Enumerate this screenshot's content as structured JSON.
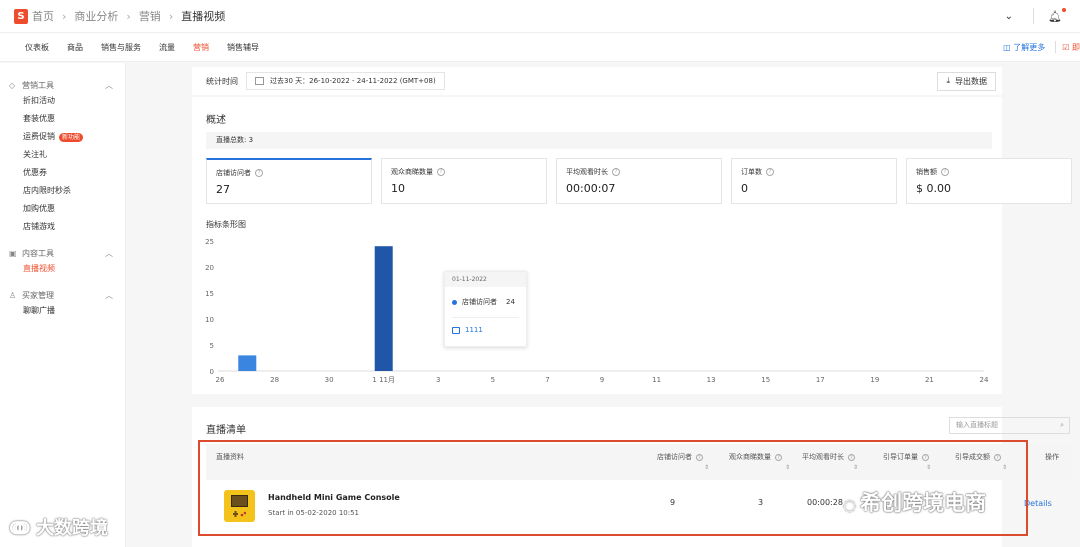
{
  "topbar": {
    "logo": "S",
    "breadcrumb": [
      "首页",
      "商业分析",
      "营销",
      "直播视频"
    ]
  },
  "tabs": [
    "仪表板",
    "商品",
    "销售与服务",
    "流量",
    "营销",
    "销售辅导"
  ],
  "active_tab": "营销",
  "tab_right": {
    "learn_more": "了解更多",
    "feedback": "即"
  },
  "sidebar": {
    "sections": [
      {
        "title": "营销工具",
        "items": [
          "折扣活动",
          "套装优惠",
          "运费促销",
          "关注礼",
          "优惠券",
          "店内限时秒杀",
          "加购优惠",
          "店铺游戏"
        ],
        "badge_item": "运费促销",
        "badge": "新功能"
      },
      {
        "title": "内容工具",
        "items": [
          "直播视频"
        ],
        "active_item": "直播视频"
      },
      {
        "title": "买家管理",
        "items": [
          "聊聊广播"
        ]
      }
    ]
  },
  "stat": {
    "label": "统计时间",
    "date_range": "过去30 天：26-10-2022 - 24-11-2022 (GMT+08)",
    "export": "导出数据"
  },
  "overview": {
    "title": "概述",
    "total": "直播总数: 3",
    "metrics": [
      {
        "label": "店铺访问者",
        "value": "27"
      },
      {
        "label": "观众商睇数量",
        "value": "10"
      },
      {
        "label": "平均观看时长",
        "value": "00:00:07"
      },
      {
        "label": "订单数",
        "value": "0"
      },
      {
        "label": "销售额",
        "value": "$ 0.00"
      }
    ],
    "chart_title": "指标条形图"
  },
  "chart_data": {
    "type": "bar",
    "x_tick_labels": [
      "26",
      "28",
      "30",
      "1 11月",
      "3",
      "5",
      "7",
      "9",
      "11",
      "13",
      "15",
      "17",
      "19",
      "21",
      "24"
    ],
    "y_tick_labels": [
      "0",
      "5",
      "10",
      "15",
      "20",
      "25"
    ],
    "ylim": [
      0,
      25
    ],
    "series": [
      {
        "name": "店铺访问者",
        "points": [
          {
            "x": "27",
            "y": 3
          },
          {
            "x": "1 11月",
            "y": 24
          }
        ]
      }
    ],
    "bar_colors": [
      "#3a85e0",
      "#1f56a8"
    ]
  },
  "tooltip": {
    "date": "01-11-2022",
    "series": "店铺访问者",
    "value": "24",
    "link": "1111"
  },
  "live_list": {
    "title": "直播清单",
    "search_placeholder": "输入直播标题",
    "columns": [
      "直播资料",
      "店铺访问者",
      "观众商睇数量",
      "平均观看时长",
      "引导订单量",
      "引导成交额",
      "操作"
    ],
    "rows": [
      {
        "name": "Handheld Mini Game Console",
        "time": "Start in 05-02-2020 10:51",
        "visitors": "9",
        "viewers": "3",
        "avg_watch": "00:00:28",
        "action": "Details"
      }
    ]
  },
  "watermarks": {
    "left": "大数跨境",
    "right": "希创跨境电商"
  },
  "colors": {
    "brand": "#ee4d2d",
    "link": "#2673dd",
    "frame": "#dd4b2f"
  }
}
